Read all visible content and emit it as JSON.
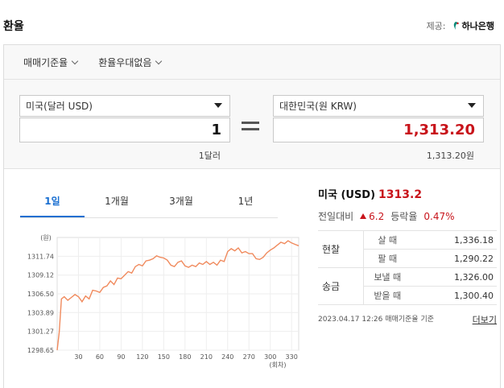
{
  "header": {
    "title": "환율",
    "provider_label": "제공:",
    "provider_name": "하나은행"
  },
  "options": {
    "rate_basis": "매매기준율",
    "preferential": "환율우대없음"
  },
  "converter": {
    "from_currency": "미국(달러 USD)",
    "from_amount": "1",
    "from_sub": "1달러",
    "to_currency": "대한민국(원 KRW)",
    "to_amount": "1,313.20",
    "to_sub": "1,313.20원"
  },
  "tabs": [
    {
      "label": "1일",
      "active": true
    },
    {
      "label": "1개월",
      "active": false
    },
    {
      "label": "3개월",
      "active": false
    },
    {
      "label": "1년",
      "active": false
    }
  ],
  "info": {
    "currency": "미국 (USD)",
    "rate": "1313.2",
    "change_label": "전일대비",
    "change_value": "6.2",
    "rate_of_change_label": "등락율",
    "rate_of_change_value": "0.47%"
  },
  "rates": {
    "cash_label": "현찰",
    "transfer_label": "송금",
    "buy_label": "살 때",
    "buy_value": "1,336.18",
    "sell_label": "팔 때",
    "sell_value": "1,290.22",
    "send_label": "보낼 때",
    "send_value": "1,326.00",
    "receive_label": "받을 때",
    "receive_value": "1,300.40"
  },
  "footer": {
    "timestamp": "2023.04.17 12:26 매매기준율 기준",
    "more_link": "더보기"
  },
  "colors": {
    "accent_blue": "#1a6fd1",
    "rate_red": "#c8141b",
    "line": "#f08a5d"
  },
  "chart_data": {
    "type": "line",
    "y_unit_label": "(원)",
    "x_unit_label": "(회차)",
    "yticks": [
      "1311.74",
      "1309.12",
      "1306.50",
      "1303.89",
      "1301.27",
      "1298.65"
    ],
    "ytick_values": [
      1311.74,
      1309.12,
      1306.5,
      1303.89,
      1301.27,
      1298.65
    ],
    "xticks": [
      30,
      60,
      90,
      120,
      150,
      180,
      210,
      240,
      270,
      300,
      330
    ],
    "xlim": [
      0,
      340
    ],
    "ylim": [
      1298.65,
      1314.36
    ],
    "points": [
      [
        0,
        1298.65
      ],
      [
        3,
        1301.2
      ],
      [
        6,
        1305.8
      ],
      [
        10,
        1306.1
      ],
      [
        15,
        1305.6
      ],
      [
        20,
        1306.0
      ],
      [
        25,
        1306.4
      ],
      [
        30,
        1306.1
      ],
      [
        35,
        1305.4
      ],
      [
        40,
        1306.2
      ],
      [
        45,
        1305.8
      ],
      [
        50,
        1307.0
      ],
      [
        55,
        1306.9
      ],
      [
        60,
        1306.7
      ],
      [
        65,
        1307.4
      ],
      [
        70,
        1307.6
      ],
      [
        75,
        1308.3
      ],
      [
        80,
        1307.8
      ],
      [
        85,
        1308.7
      ],
      [
        90,
        1308.6
      ],
      [
        95,
        1309.1
      ],
      [
        100,
        1309.6
      ],
      [
        105,
        1309.4
      ],
      [
        110,
        1310.3
      ],
      [
        115,
        1310.6
      ],
      [
        120,
        1310.4
      ],
      [
        125,
        1311.1
      ],
      [
        130,
        1311.2
      ],
      [
        135,
        1311.4
      ],
      [
        140,
        1311.8
      ],
      [
        145,
        1311.6
      ],
      [
        150,
        1311.5
      ],
      [
        155,
        1311.2
      ],
      [
        160,
        1310.5
      ],
      [
        165,
        1310.3
      ],
      [
        170,
        1310.9
      ],
      [
        175,
        1311.1
      ],
      [
        180,
        1310.4
      ],
      [
        185,
        1310.2
      ],
      [
        190,
        1310.5
      ],
      [
        195,
        1310.3
      ],
      [
        200,
        1310.8
      ],
      [
        205,
        1310.6
      ],
      [
        210,
        1311.0
      ],
      [
        215,
        1310.6
      ],
      [
        220,
        1310.9
      ],
      [
        225,
        1310.5
      ],
      [
        230,
        1311.2
      ],
      [
        235,
        1311.0
      ],
      [
        240,
        1312.4
      ],
      [
        245,
        1312.8
      ],
      [
        250,
        1312.5
      ],
      [
        255,
        1312.9
      ],
      [
        260,
        1312.2
      ],
      [
        265,
        1312.4
      ],
      [
        270,
        1312.1
      ],
      [
        275,
        1312.1
      ],
      [
        280,
        1311.4
      ],
      [
        285,
        1311.3
      ],
      [
        290,
        1311.6
      ],
      [
        295,
        1312.2
      ],
      [
        300,
        1312.6
      ],
      [
        305,
        1312.9
      ],
      [
        310,
        1313.3
      ],
      [
        315,
        1313.7
      ],
      [
        320,
        1313.5
      ],
      [
        325,
        1313.9
      ],
      [
        330,
        1313.6
      ],
      [
        335,
        1313.4
      ],
      [
        340,
        1313.2
      ]
    ]
  }
}
